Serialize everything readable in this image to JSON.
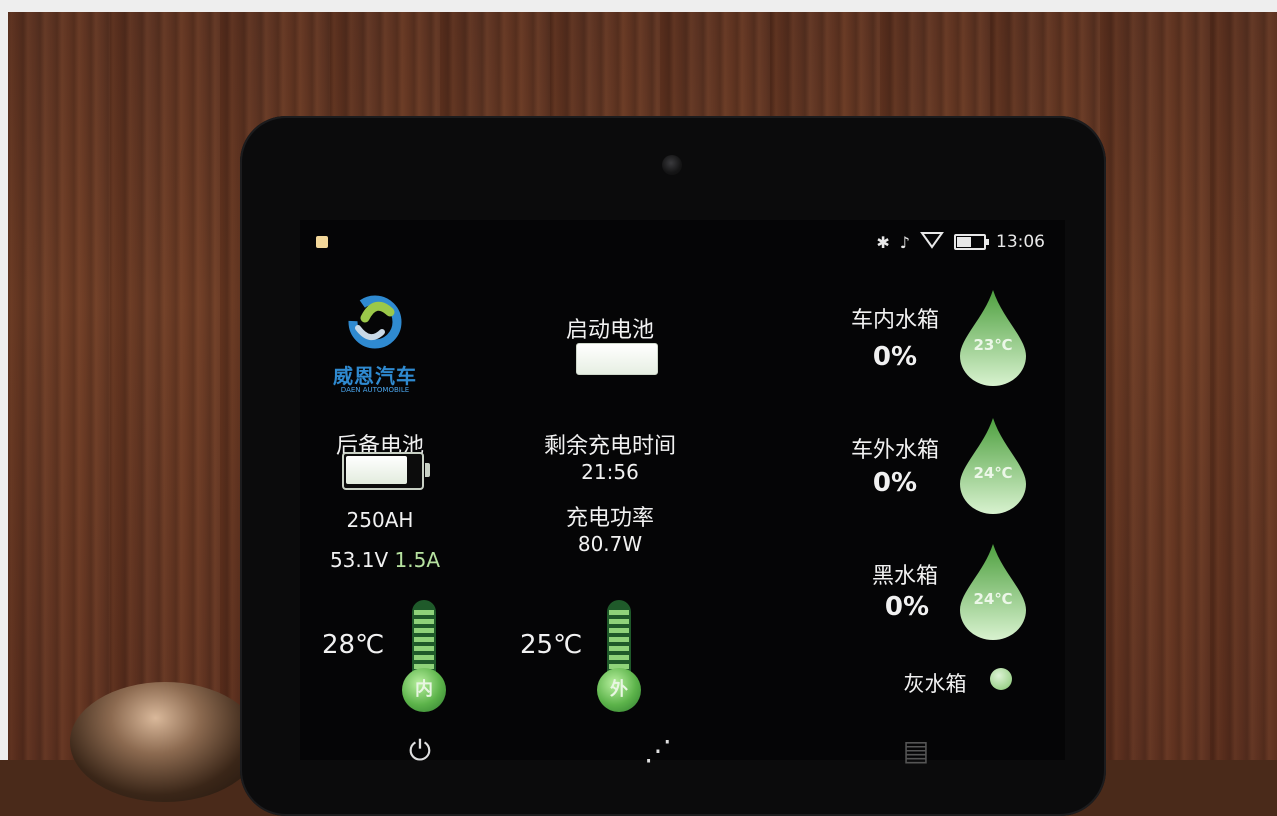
{
  "status_bar": {
    "time": "13:06",
    "bluetooth_icon": "bluetooth-icon",
    "mute_icon": "mute-icon",
    "wifi_icon": "wifi-icon",
    "battery_level": 0.6
  },
  "logo": {
    "name": "威恩汽车",
    "sub": "DAEN AUTOMOBILE"
  },
  "starter_battery": {
    "label": "启动电池",
    "value": ""
  },
  "backup_battery": {
    "label": "后备电池",
    "percent_text": "",
    "capacity": "250AH",
    "voltage": "53.1V",
    "current": "1.5A",
    "fill_fraction": 0.85
  },
  "charging": {
    "remaining_label": "剩余充电时间",
    "remaining_value": "21:56",
    "power_label": "充电功率",
    "power_value": "80.7W"
  },
  "temperatures": {
    "inside_value": "28℃",
    "inside_label": "内",
    "outside_value": "25℃",
    "outside_label": "外"
  },
  "tanks": {
    "inner": {
      "label": "车内水箱",
      "percent": "0%",
      "temp": "23℃"
    },
    "outer": {
      "label": "车外水箱",
      "percent": "0%",
      "temp": "24℃"
    },
    "black": {
      "label": "黑水箱",
      "percent": "0%",
      "temp": "24℃"
    },
    "grey": {
      "label": "灰水箱"
    }
  },
  "bottom_nav": {
    "power_icon": "power-icon",
    "chart_icon": "chart-icon",
    "document_icon": "document-icon"
  },
  "colors": {
    "accent_green": "#5cb34a",
    "text": "#f1f1f1",
    "current_green": "#b7e3a0"
  }
}
